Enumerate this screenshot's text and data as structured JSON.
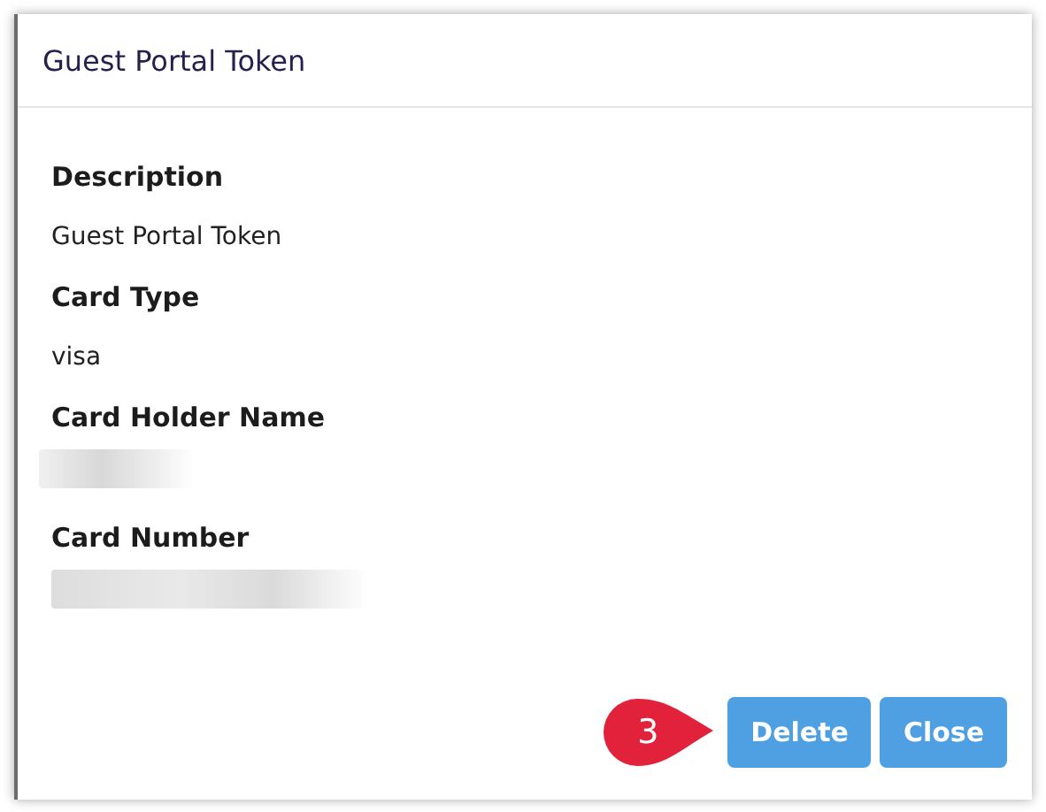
{
  "dialog": {
    "title": "Guest Portal Token"
  },
  "fields": [
    {
      "label": "Description",
      "kind": "text",
      "value": "Guest Portal Token"
    },
    {
      "label": "Card Type",
      "kind": "text",
      "value": "visa"
    },
    {
      "label": "Card Holder Name",
      "kind": "redacted"
    },
    {
      "label": "Card Number",
      "kind": "redacted"
    }
  ],
  "callout": {
    "number": "3"
  },
  "buttons": [
    "Delete",
    "Close"
  ]
}
